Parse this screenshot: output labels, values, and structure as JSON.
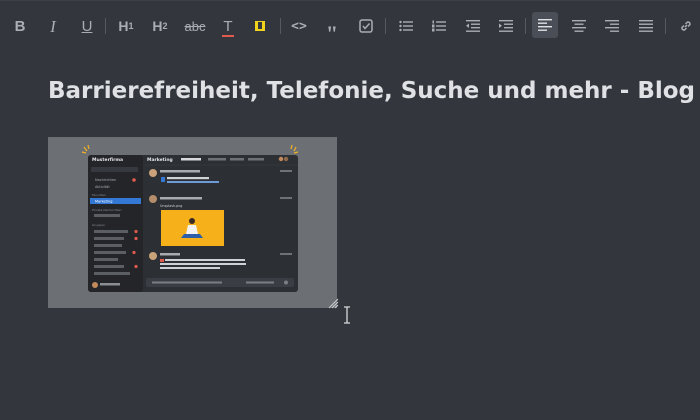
{
  "toolbar": {
    "bold": "B",
    "italic": "I",
    "underline": "U",
    "h1": "H",
    "h1_sub": "1",
    "h2": "H",
    "h2_sub": "2",
    "strike": "abc",
    "text_color": "T",
    "code": "<>",
    "quote": "\""
  },
  "editor": {
    "title": "Barrierefreiheit, Telefonie, Suche und mehr - Blog"
  },
  "embedded_image": {
    "channel": "Marketing",
    "workspace": "Musterfirma",
    "sidebar_items": [
      "Nachrichten",
      "Aktivität",
      "Favoriten",
      "Marketing",
      "Private Nachrichten",
      "Gruppen"
    ],
    "attachment_label": "Unsplash.png"
  }
}
